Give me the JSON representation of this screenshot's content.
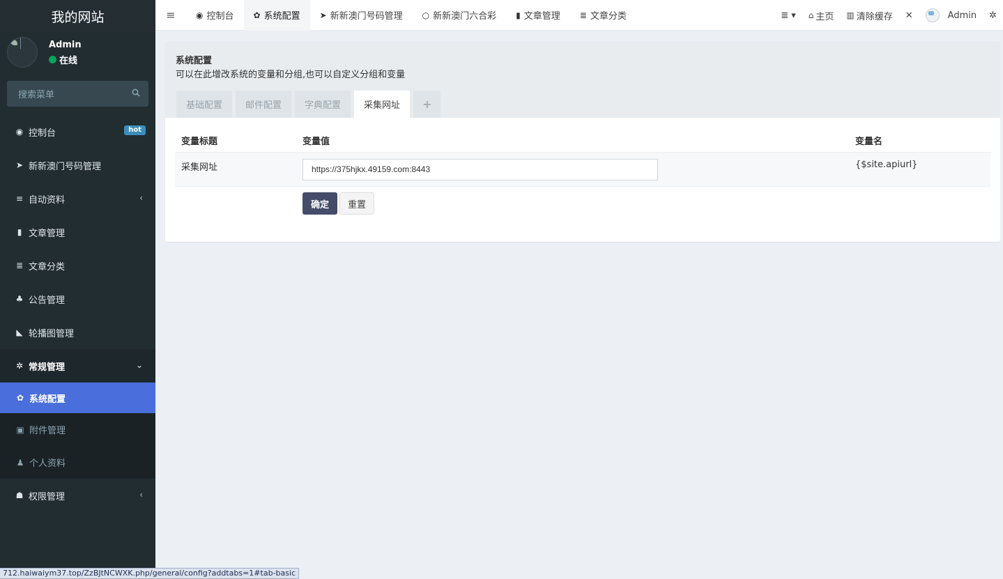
{
  "sidebar": {
    "logo": "我的网站",
    "user": {
      "name": "Admin",
      "status": "在线"
    },
    "search_placeholder": "搜索菜单",
    "items": [
      {
        "icon": "dashboard-icon",
        "glyph": "◉",
        "label": "控制台",
        "badge": "hot"
      },
      {
        "icon": "send-icon",
        "glyph": "➤",
        "label": "新新澳门号码管理"
      },
      {
        "icon": "list-icon",
        "glyph": "≡",
        "label": "自动资料",
        "caret": "‹"
      },
      {
        "icon": "bookmark-icon",
        "glyph": "▮",
        "label": "文章管理"
      },
      {
        "icon": "list-icon",
        "glyph": "≣",
        "label": "文章分类"
      },
      {
        "icon": "bell-icon",
        "glyph": "♣",
        "label": "公告管理"
      },
      {
        "icon": "image-icon",
        "glyph": "◣",
        "label": "轮播图管理"
      },
      {
        "icon": "cogs-icon",
        "glyph": "✲",
        "label": "常规管理",
        "caret": "⌄"
      },
      {
        "icon": "users-icon",
        "glyph": "☗",
        "label": "权限管理",
        "caret": "‹"
      }
    ],
    "submenu": [
      {
        "icon": "gear-icon",
        "glyph": "✿",
        "label": "系统配置"
      },
      {
        "icon": "picture-icon",
        "glyph": "▣",
        "label": "附件管理"
      },
      {
        "icon": "user-icon",
        "glyph": "♟",
        "label": "个人资料"
      }
    ]
  },
  "status_url": "712.haiwaiym37.top/ZzBJtNCWXK.php/general/config?addtabs=1#tab-basic",
  "topbar": {
    "toggle_glyph": "≡",
    "tabs": [
      {
        "icon": "dashboard-icon",
        "glyph": "◉",
        "label": "控制台"
      },
      {
        "icon": "gear-icon",
        "glyph": "✿",
        "label": "系统配置"
      },
      {
        "icon": "send-icon",
        "glyph": "➤",
        "label": "新新澳门号码管理"
      },
      {
        "icon": "circle-icon",
        "glyph": "○",
        "label": "新新澳门六合彩"
      },
      {
        "icon": "bookmark-icon",
        "glyph": "▮",
        "label": "文章管理"
      },
      {
        "icon": "list-icon",
        "glyph": "≣",
        "label": "文章分类"
      }
    ],
    "right": {
      "menu_glyph": "≣ ▾",
      "home_glyph": "⌂",
      "home_label": "主页",
      "clear_glyph": "▥",
      "clear_label": "清除缓存",
      "fullscreen_glyph": "✕",
      "admin_label": "Admin",
      "settings_glyph": "✲"
    }
  },
  "panel": {
    "title": "系统配置",
    "description": "可以在此增改系统的变量和分组,也可以自定义分组和变量",
    "tabs": [
      "基础配置",
      "邮件配置",
      "字典配置",
      "采集网址"
    ],
    "add_tab": "+",
    "table": {
      "headers": [
        "变量标题",
        "变量值",
        "变量名"
      ],
      "row": {
        "title": "采集网址",
        "value": "https://375hjkx.49159.com:8443",
        "name": "{$site.apiurl}"
      }
    },
    "buttons": {
      "submit": "确定",
      "reset": "重置"
    }
  }
}
